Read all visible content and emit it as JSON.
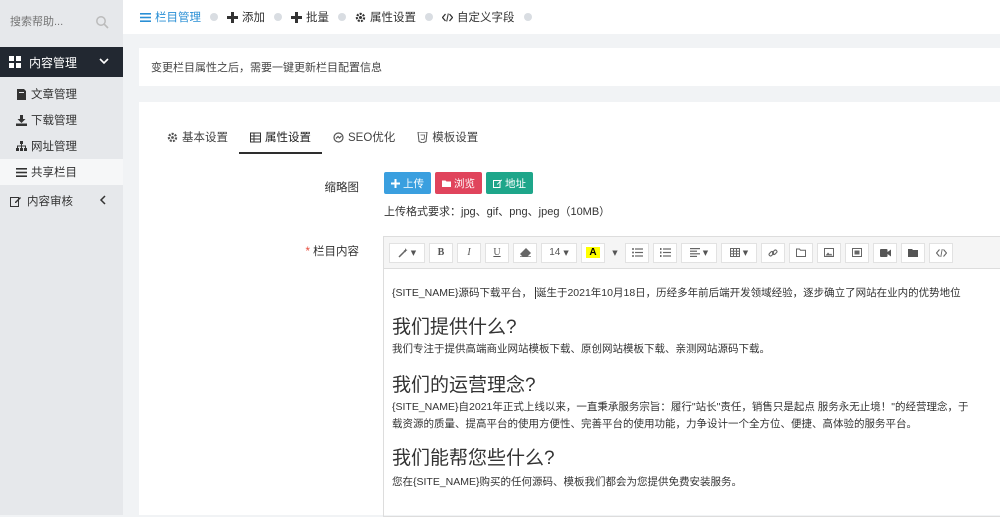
{
  "sidebar": {
    "search_placeholder": "搜索帮助...",
    "group": {
      "label": "内容管理"
    },
    "items": [
      {
        "label": "文章管理"
      },
      {
        "label": "下载管理"
      },
      {
        "label": "网址管理"
      },
      {
        "label": "共享栏目"
      }
    ],
    "review": {
      "label": "内容审核"
    }
  },
  "breadcrumb": [
    {
      "label": "栏目管理"
    },
    {
      "label": "添加"
    },
    {
      "label": "批量"
    },
    {
      "label": "属性设置"
    },
    {
      "label": "自定义字段"
    }
  ],
  "notice": "变更栏目属性之后，需要一键更新栏目配置信息",
  "tabs": [
    {
      "label": "基本设置"
    },
    {
      "label": "属性设置"
    },
    {
      "label": "SEO优化"
    },
    {
      "label": "模板设置"
    }
  ],
  "form": {
    "thumb_label": "缩略图",
    "upload_btn": "上传",
    "browse_btn": "浏览",
    "url_btn": "地址",
    "hint": "上传格式要求：jpg、gif、png、jpeg（10MB）",
    "content_label": "栏目内容",
    "required_mark": "*"
  },
  "editor": {
    "font_size": "14",
    "content": {
      "intro_a": "{SITE_NAME}源码下载平台，",
      "intro_b": "诞生于2021年10月18日，历经多年前后端开发领域经验，逐步确立了网站在业内的优势地位",
      "h1": "我们提供什么?",
      "p1": "我们专注于提供高端商业网站模板下载、原创网站模板下载、亲测网站源码下载。",
      "h2": "我们的运营理念?",
      "p2a": "{SITE_NAME}自2021年正式上线以来，一直秉承服务宗旨：履行\"站长\"责任，销售只是起点 服务永无止境！\"的经营理念，于",
      "p2b": "载资源的质量、提高平台的使用方便性、完善平台的使用功能，力争设计一个全方位、便捷、高体验的服务平台。",
      "h3": "我们能帮您些什么?",
      "p3": "您在{SITE_NAME}购买的任何源码、模板我们都会为您提供免费安装服务。"
    }
  },
  "colors": {
    "accent": "#2a8fd5",
    "sidebar_dark": "#222831",
    "upload": "#3a9fdf",
    "browse": "#e0445c",
    "url": "#1ea68a"
  }
}
